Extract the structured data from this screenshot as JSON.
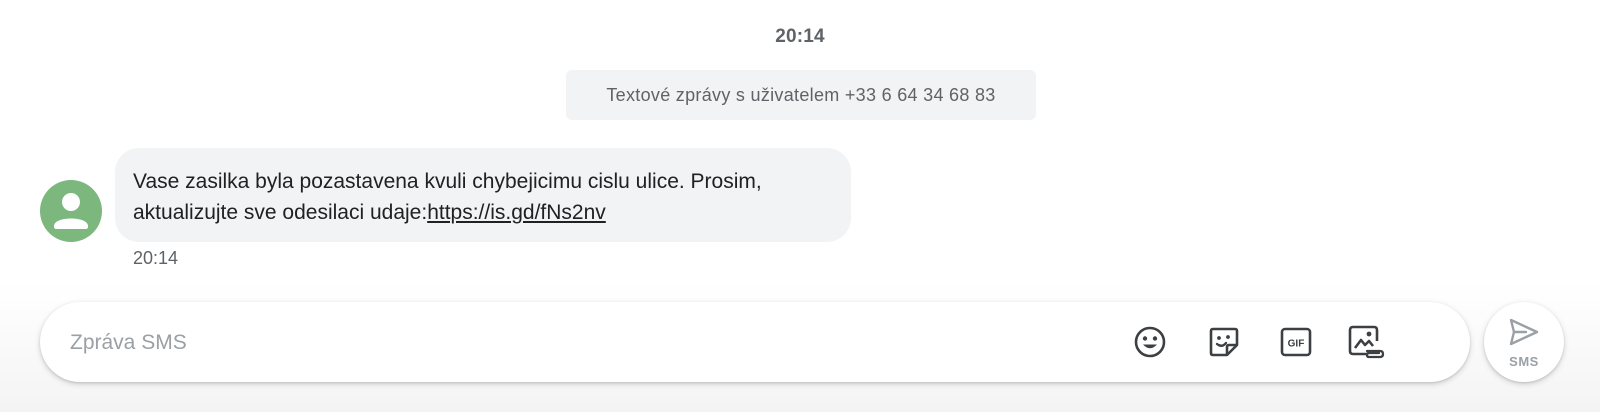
{
  "conversation": {
    "top_timestamp": "20:14",
    "info_banner": "Textové zprávy s uživatelem +33 6 64 34 68 83"
  },
  "message": {
    "text_part1": "Vase zasilka byla pozastavena kvuli chybejicimu cislu ulice. Prosim, aktualizujte sve odesilaci udaje:",
    "link": "https://is.gd/fNs2nv",
    "time": "20:14",
    "avatar_color": "#7cb77e"
  },
  "composer": {
    "placeholder": "Zpráva SMS",
    "icons": [
      "emoji-icon",
      "sticker-icon",
      "gif-icon",
      "attach-media-icon"
    ],
    "gif_label": "GIF"
  },
  "send": {
    "label": "SMS"
  }
}
